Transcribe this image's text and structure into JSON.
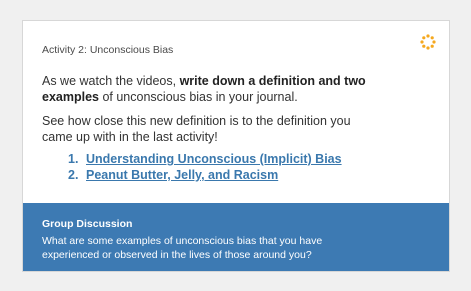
{
  "activity": {
    "title": "Activity 2: Unconscious Bias",
    "icon": "loading-spinner-icon",
    "accent_color": "#f5a81e"
  },
  "instructions": {
    "p1_lead": "As we watch the videos, ",
    "p1_bold": "write down a definition and two examples",
    "p1_tail": " of unconscious bias in your journal.",
    "p2": "See how close this new definition is to the definition you came up with in the last activity!"
  },
  "videos": [
    {
      "number": "1.",
      "label": "Understanding Unconscious (Implicit) Bias"
    },
    {
      "number": "2.",
      "label": "Peanut Butter, Jelly, and Racism"
    }
  ],
  "discussion": {
    "title": "Group Discussion",
    "text": "What are some examples of unconscious bias that you have experienced or observed in the lives of those around you?",
    "background_color": "#3d7ab3"
  }
}
